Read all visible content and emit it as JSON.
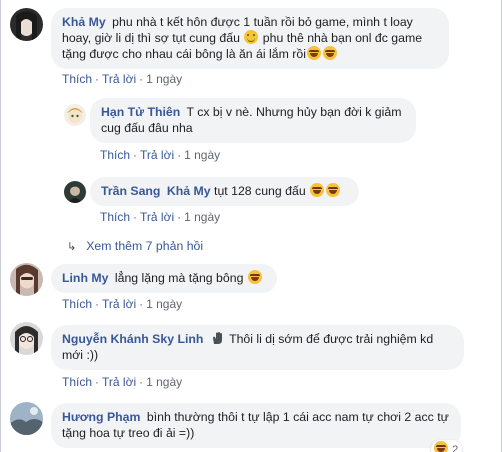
{
  "actions": {
    "like": "Thích",
    "reply": "Trả lời",
    "sep": "·"
  },
  "comments": [
    {
      "name": "Khả My",
      "text_1": "phu nhà t kết hôn được 1 tuần rồi bỏ game, mình t loay hoay, giờ li dị thì sợ tụt cung đấu",
      "text_2": "phu thê nhà bạn onl đc game tặng được cho nhau cái bông là ăn ái lắm rồi",
      "time": "1 ngày"
    },
    {
      "name": "Hạn Tử Thiên",
      "text": "T cx bị v nè. Nhưng hủy bạn đời k giảm cug đấu đâu nha",
      "time": "1 ngày"
    },
    {
      "name": "Trần Sang",
      "mention": "Khả My",
      "text": "tụt 128 cung đấu",
      "time": "1 ngày"
    },
    {
      "name": "Linh My",
      "text": "lẳng lặng mà tặng bông",
      "time": "1 ngày"
    },
    {
      "name": "Nguyễn Khánh Sky Linh",
      "text": "Thôi li dị sớm để được trải nghiệm kd mới :))",
      "time": "1 ngày"
    },
    {
      "name": "Hương Phạm",
      "text": "bình thường thôi t tự lập 1 cái acc nam tự chơi 2 acc tự tặng hoa tự treo đi ải =))",
      "reaction_count": "2"
    }
  ],
  "more_replies": "Xem thêm 7 phản hồi",
  "icons": {
    "laugh": "laughing-emoji-icon",
    "smile": "smiling-emoji-icon",
    "wave": "waving-hand-icon",
    "reply_arrow": "reply-arrow-icon"
  },
  "colors": {
    "name_link": "#385898",
    "bubble_bg": "#f2f3f5",
    "meta": "#606770"
  }
}
